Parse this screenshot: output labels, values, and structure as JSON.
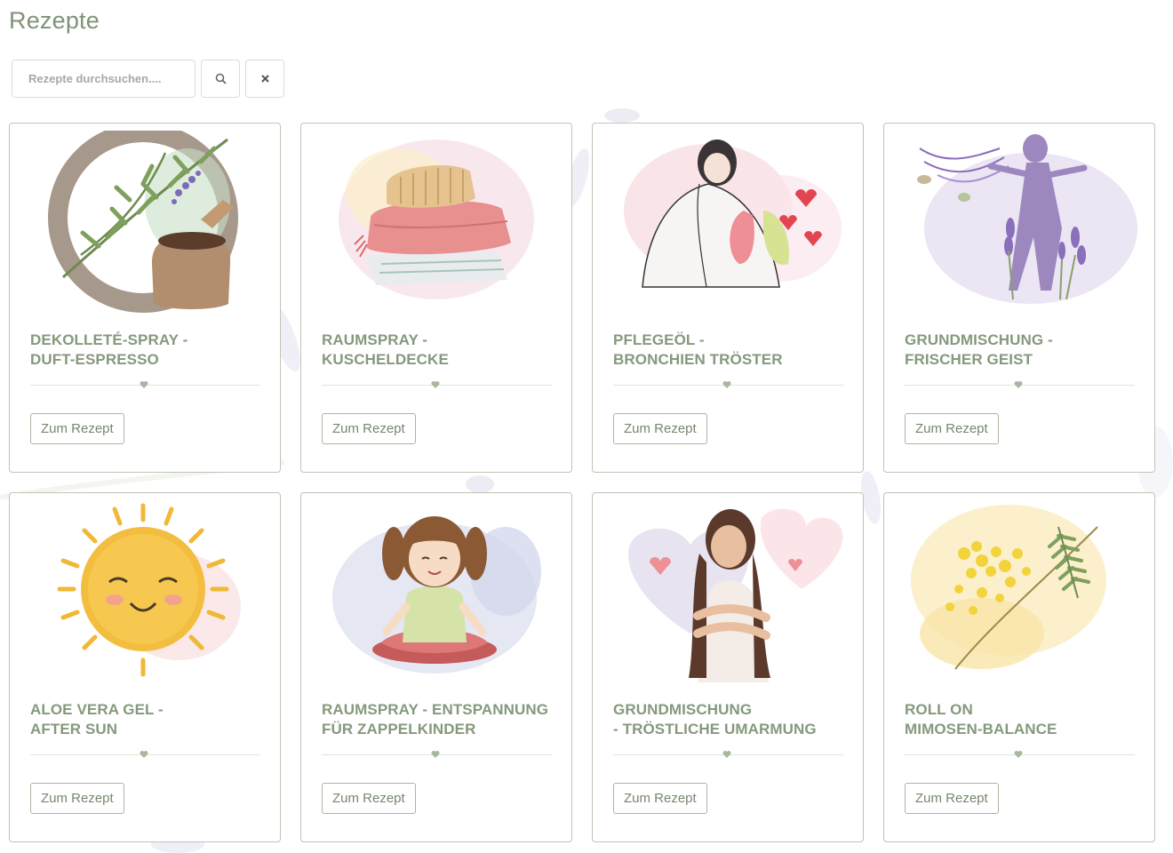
{
  "page": {
    "title": "Rezepte"
  },
  "search": {
    "placeholder": "Rezepte durchsuchen....",
    "value": "",
    "search_icon": "search-icon",
    "clear_icon": "close-icon"
  },
  "colors": {
    "accent": "#85997c",
    "card_border": "#bcc6b5",
    "button_text": "#76886e"
  },
  "recipes": [
    {
      "title": "Dekolleté-Spray -\nDuft-Espresso",
      "button_label": "Zum Rezept",
      "image": "rosemary-coffee-illustration"
    },
    {
      "title": "Raumspray -\nKuscheldecke",
      "button_label": "Zum Rezept",
      "image": "blanket-stack-illustration"
    },
    {
      "title": "Pflegeöl -\nBronchien Tröster",
      "button_label": "Zum Rezept",
      "image": "woman-blanket-lungs-illustration"
    },
    {
      "title": "Grundmischung -\nFrischer Geist",
      "button_label": "Zum Rezept",
      "image": "lavender-silhouette-illustration"
    },
    {
      "title": "Aloe Vera Gel -\nAfter Sun",
      "button_label": "Zum Rezept",
      "image": "smiling-sun-illustration"
    },
    {
      "title": "Raumspray - Entspannung\nfür Zappelkinder",
      "button_label": "Zum Rezept",
      "image": "meditating-girl-illustration"
    },
    {
      "title": "Grundmischung\n- Tröstliche Umarmung",
      "button_label": "Zum Rezept",
      "image": "self-hug-woman-illustration"
    },
    {
      "title": "Roll On\nMimosen-Balance",
      "button_label": "Zum Rezept",
      "image": "mimosa-illustration"
    }
  ]
}
